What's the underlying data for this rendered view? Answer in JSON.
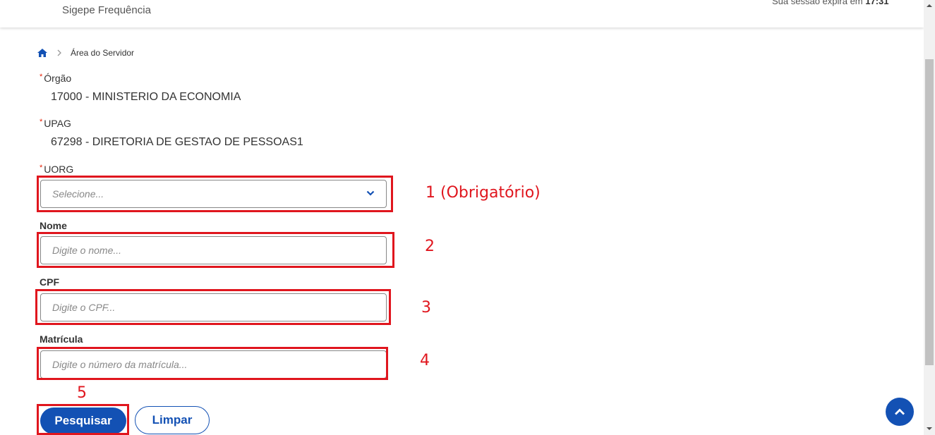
{
  "header": {
    "app_name": "Sigepe Frequência",
    "session_prefix": "Sua sessão expira em ",
    "session_time": "17:31"
  },
  "breadcrumb": {
    "home_icon": "home-icon",
    "current": "Área do Servidor"
  },
  "form": {
    "orgao": {
      "label": "Órgão",
      "value": "17000 - MINISTERIO DA ECONOMIA",
      "required_mark": "*"
    },
    "upag": {
      "label": "UPAG",
      "value": "67298 - DIRETORIA DE GESTAO DE PESSOAS1",
      "required_mark": "*"
    },
    "uorg": {
      "label": "UORG",
      "placeholder": "Selecione...",
      "required_mark": "*",
      "icon": "chevron-down-icon"
    },
    "nome": {
      "label": "Nome",
      "placeholder": "Digite o nome..."
    },
    "cpf": {
      "label": "CPF",
      "placeholder": "Digite o CPF..."
    },
    "matricula": {
      "label": "Matrícula",
      "placeholder": "Digite o número da matrícula..."
    }
  },
  "buttons": {
    "search": "Pesquisar",
    "clear": "Limpar"
  },
  "annotations": {
    "a1": "1 (Obrigatório)",
    "a2": "2",
    "a3": "3",
    "a4": "4",
    "a5": "5"
  },
  "colors": {
    "primary": "#1351b4",
    "annotation_red": "#e0161e"
  }
}
